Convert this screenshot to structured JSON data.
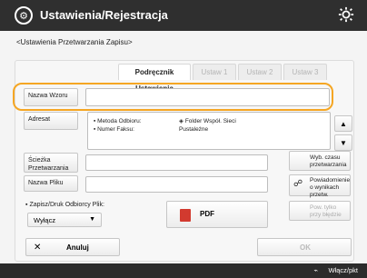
{
  "app": {
    "title": "Ustawienia/Rejestracja",
    "breadcrumb": "<Ustawienia Przetwarzania Zapisu>"
  },
  "tabs": [
    {
      "label": "Podręcznik Ustawienia",
      "active": true
    },
    {
      "label": "Ustaw 1",
      "active": false
    },
    {
      "label": "Ustaw 2",
      "active": false
    },
    {
      "label": "Ustaw 3",
      "active": false
    }
  ],
  "fields": {
    "name_button": "Nazwa Wzoru",
    "name_value": "",
    "recipient_button": "Adresat",
    "workflow_button": "Ścieżka Przetwarzania",
    "workflow_value": "",
    "file_name_button": "Nazwa Pliku",
    "file_name_value": ""
  },
  "recipient_list": {
    "col1_line1": "Metoda Odbioru:",
    "col1_line2": "Numer Faksu:",
    "col2_line1": "Folder Współ. Sieci",
    "col2_line2": "Pustależne"
  },
  "side_buttons": {
    "send_time": "Wyb. czasu przetwarzania",
    "notify": "Powiadomienie o wynikach przetw.",
    "only_errors": "Pow. tylko przy błędzie"
  },
  "format_group": {
    "label": "Zapisz/Druk Odbiorcy Plik:",
    "select_value": "Wyłącz",
    "pdf_label": "PDF"
  },
  "bottom": {
    "cancel": "Anuluj",
    "ok": "OK"
  },
  "status": {
    "monitor": "Włącz/pkt"
  }
}
